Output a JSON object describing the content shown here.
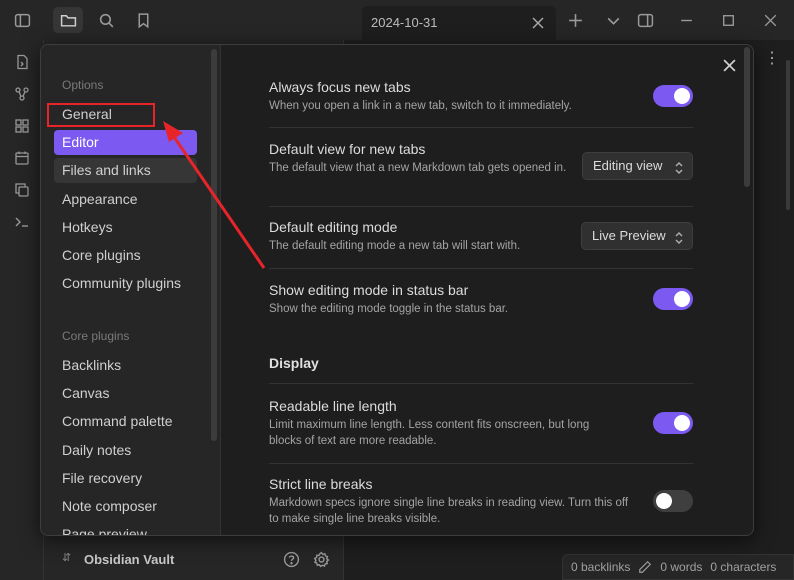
{
  "titlebar": {
    "tab_title": "2024-10-31"
  },
  "left_panel": {
    "vault_name": "Obsidian Vault"
  },
  "statusbar": {
    "backlinks": "0 backlinks",
    "words": "0 words",
    "characters": "0 characters"
  },
  "settings_sidebar": {
    "options_heading": "Options",
    "options_items": [
      "General",
      "Editor",
      "Files and links",
      "Appearance",
      "Hotkeys",
      "Core plugins",
      "Community plugins"
    ],
    "core_plugins_heading": "Core plugins",
    "core_plugins_items": [
      "Backlinks",
      "Canvas",
      "Command palette",
      "Daily notes",
      "File recovery",
      "Note composer",
      "Page preview"
    ],
    "active_item": "Editor"
  },
  "settings_main": {
    "settings": [
      {
        "name": "Always focus new tabs",
        "desc": "When you open a link in a new tab, switch to it immediately.",
        "control": "toggle",
        "on": true
      },
      {
        "name": "Default view for new tabs",
        "desc": "The default view that a new Markdown tab gets opened in.",
        "control": "dropdown",
        "value": "Editing view"
      },
      {
        "name": "Default editing mode",
        "desc": "The default editing mode a new tab will start with.",
        "control": "dropdown",
        "value": "Live Preview"
      },
      {
        "name": "Show editing mode in status bar",
        "desc": "Show the editing mode toggle in the status bar.",
        "control": "toggle",
        "on": true
      },
      {
        "name": "Readable line length",
        "desc": "Limit maximum line length. Less content fits onscreen, but long blocks of text are more readable.",
        "control": "toggle",
        "on": true
      },
      {
        "name": "Strict line breaks",
        "desc": "Markdown specs ignore single line breaks in reading view. Turn this off to make single line breaks visible.",
        "control": "toggle",
        "on": false
      }
    ],
    "section_display": "Display"
  },
  "colors": {
    "accent": "#7c5af2",
    "annotation": "#e8242b"
  }
}
